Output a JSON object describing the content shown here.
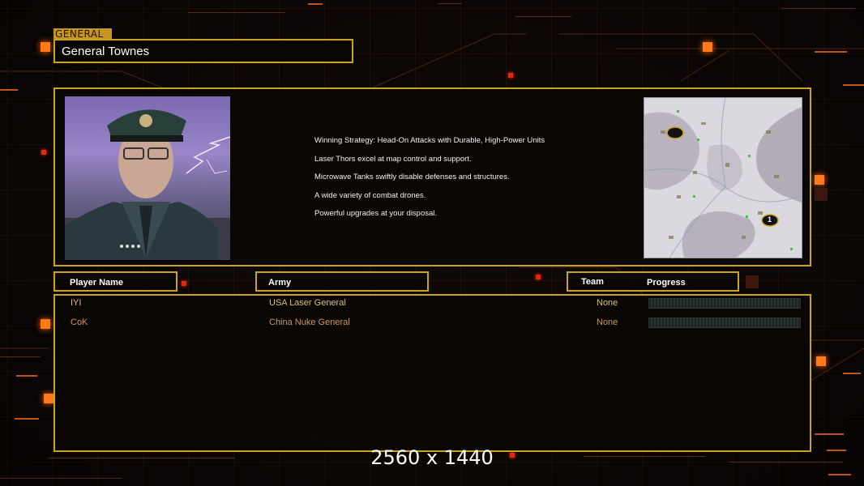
{
  "section_tag": "GENERAL",
  "general_name": "General Townes",
  "strategy_lines": [
    "Winning Strategy: Head-On Attacks with Durable, High-Power Units",
    "Laser Thors excel at map control and support.",
    "Microwave Tanks swiftly disable defenses and structures.",
    "A wide variety of combat drones.",
    "Powerful upgrades at your disposal."
  ],
  "minimap_markers": [
    "1"
  ],
  "columns": {
    "player": "Player Name",
    "army": "Army",
    "team": "Team",
    "progress": "Progress"
  },
  "players": [
    {
      "name": "IYI",
      "army": "USA Laser General",
      "team": "None",
      "progress": 0,
      "color": "#d8c36a"
    },
    {
      "name": "CoK",
      "army": "China Nuke General",
      "team": "None",
      "progress": 0,
      "color": "#c99b5d"
    }
  ],
  "resolution_label": "2560 x 1440",
  "colors": {
    "frame": "#c9a51c",
    "accent": "#ff7a1a",
    "tag_bg": "#c8951e"
  }
}
